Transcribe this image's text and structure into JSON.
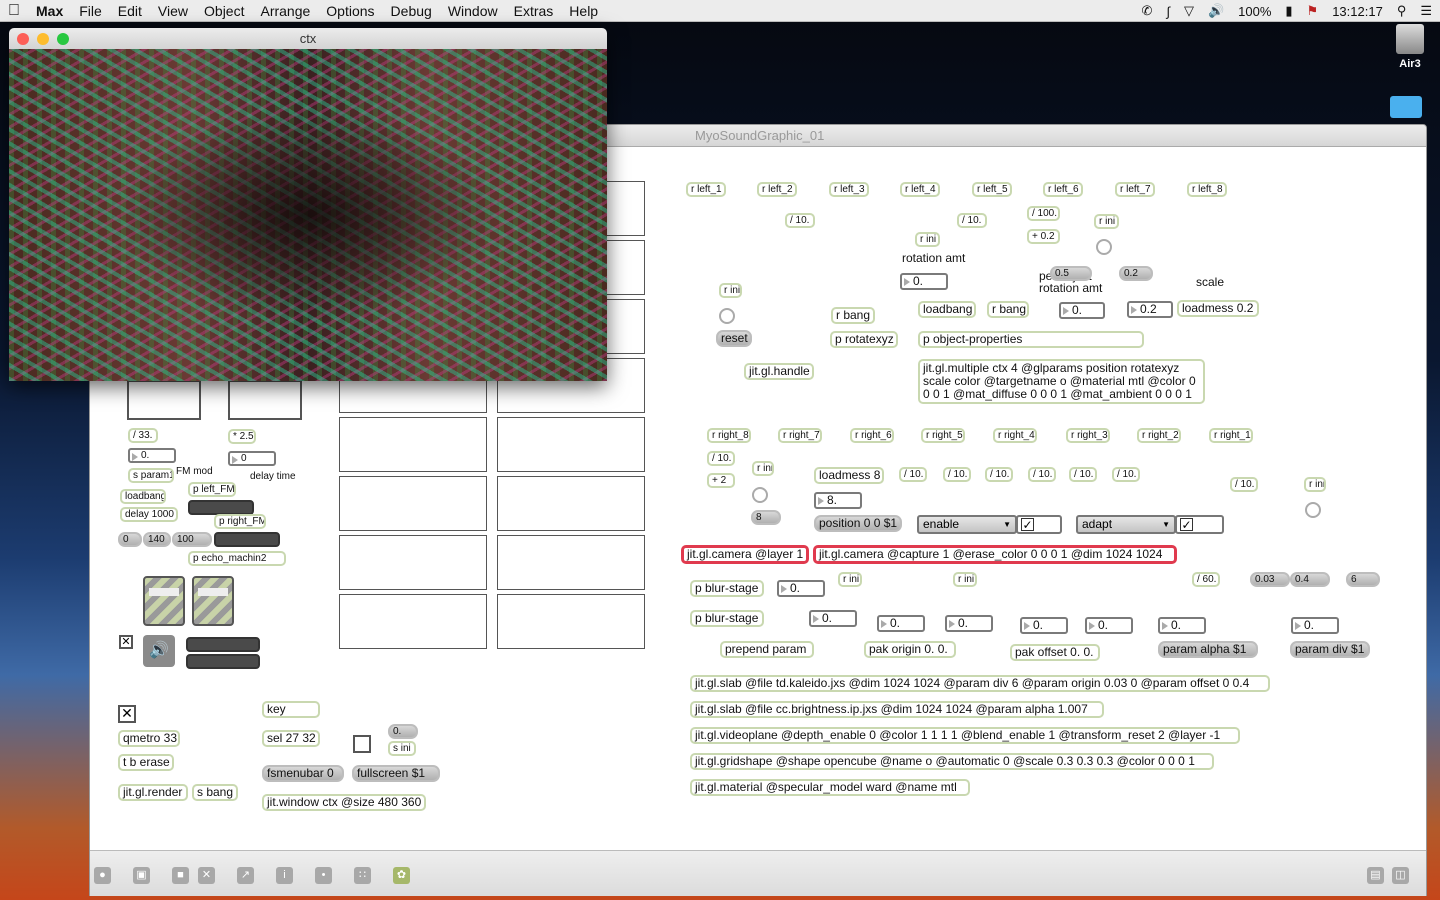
{
  "menubar": {
    "apple": "",
    "app": "Max",
    "items": [
      "File",
      "Edit",
      "View",
      "Object",
      "Arrange",
      "Options",
      "Debug",
      "Window",
      "Extras",
      "Help"
    ],
    "battery": "100%",
    "clock": "13:12:17"
  },
  "desktop": {
    "drive_label": "Air3"
  },
  "ctx_window": {
    "title": "ctx"
  },
  "patcher": {
    "title": "MyoSoundGraphic_01",
    "labels": {
      "rotation_amt": "rotation amt",
      "per_object": "per object",
      "per_rotation": "rotation amt",
      "scale": "scale",
      "fm_mod": "FM mod",
      "delay_time": "delay time"
    },
    "left": [
      "r left_1",
      "r left_2",
      "r left_3",
      "r left_4",
      "r left_5",
      "r left_6",
      "r left_7",
      "r left_8"
    ],
    "right": [
      "r right_8",
      "r right_7",
      "r right_6",
      "r right_5",
      "r right_4",
      "r right_3",
      "r right_2",
      "r right_1"
    ],
    "o": {
      "div10a": "/ 10.",
      "div10b": "/ 10.",
      "div100": "/ 100.",
      "plus02": "+ 0.2",
      "rini1": "r ini",
      "rini2": "r ini",
      "rini3": "r ini",
      "num_rot": "0.",
      "num_per": "0.",
      "num_scale": "0.2",
      "msg05": "0.5",
      "msg02": "0.2",
      "loadmess02": "loadmess 0.2",
      "reset": "reset",
      "rbang1": "r bang",
      "rotatexyz": "p rotatexyz",
      "loadbang": "loadbang",
      "rbang2": "r bang",
      "objprops": "p object-properties",
      "multiple": "jit.gl.multiple ctx 4 @glparams position rotatexyz scale color @targetname o @material mtl @color 0 0 0 1 @mat_diffuse 0 0 0 1 @mat_ambient 0 0 0 1",
      "handle": "jit.gl.handle",
      "r_div10": "/ 10.",
      "plus2": "+ 2",
      "rini4": "r ini",
      "msg8": "8",
      "loadmess8": "loadmess 8",
      "num8": "8.",
      "rd": [
        "/ 10.",
        "/ 10.",
        "/ 10.",
        "/ 10.",
        "/ 10.",
        "/ 10."
      ],
      "rd7": "/ 10.",
      "position": "position 0 0 $1",
      "enable": "enable",
      "adapt": "adapt",
      "rini5": "r ini",
      "cam1": "jit.gl.camera @layer 1",
      "cam2": "jit.gl.camera @capture 1 @erase_color 0 0 0 1 @dim 1024 1024",
      "blur1": "p blur-stage",
      "blur2": "p blur-stage",
      "num_b1": "0.",
      "num_b2": "0.",
      "rini6": "r ini",
      "rini7": "r ini",
      "div60": "/ 60.",
      "m003": "0.03",
      "m04": "0.4",
      "m6": "6",
      "nums": [
        "0.",
        "0.",
        "0.",
        "0.",
        "0.",
        "0."
      ],
      "prepend": "prepend param",
      "pak_origin": "pak origin 0. 0.",
      "pak_offset": "pak offset 0. 0.",
      "param_alpha": "param alpha $1",
      "param_div": "param div $1",
      "slab1": "jit.gl.slab @file td.kaleido.jxs @dim 1024 1024 @param div 6 @param origin 0.03 0 @param offset 0 0.4",
      "slab2": "jit.gl.slab @file cc.brightness.ip.jxs @dim 1024 1024 @param alpha 1.007",
      "videoplane": "jit.gl.videoplane @depth_enable 0 @color 1 1 1 1 @blend_enable 1 @transform_reset 2 @layer -1",
      "gridshape": "jit.gl.gridshape @shape opencube @name o @automatic 0 @scale 0.3 0.3 0.3 @color 0 0 0 1",
      "material": "jit.gl.material @specular_model ward @name mtl",
      "div33": "/ 33.",
      "mul25": "* 2.5",
      "num_fm": "0.",
      "num_delay": "0",
      "sparam1": "s param1",
      "loadbang2": "loadbang",
      "delay1000": "delay 1000",
      "m0": "0",
      "m140": "140",
      "m100": "100",
      "leftfm": "p left_FM",
      "rightfm": "p right_FM",
      "echo": "p echo_machin2",
      "qmetro": "qmetro 33",
      "tberase": "t b erase",
      "render": "jit.gl.render",
      "sbang": "s bang",
      "key": "key",
      "sel": "sel 27 32",
      "m0b": "0.",
      "sini": "s ini",
      "fsmenubar": "fsmenubar 0",
      "fullscreen": "fullscreen $1",
      "window": "jit.window ctx @size 480 360"
    }
  },
  "toolbar": {
    "icons": [
      "lock-icon",
      "presentation-icon",
      "objects-icon",
      "clear-icon",
      "debug-icon",
      "inspector-icon",
      "patch-cord-icon",
      "grid-icon",
      "snapshot-icon"
    ]
  }
}
